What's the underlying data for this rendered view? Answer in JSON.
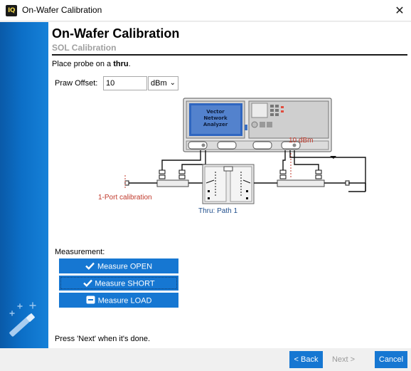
{
  "window": {
    "title": "On-Wafer Calibration",
    "app_icon_text": "IQ",
    "close_glyph": "✕"
  },
  "header": {
    "title": "On-Wafer Calibration",
    "subtitle": "SOL Calibration"
  },
  "instruction": {
    "prefix": "Place probe on a ",
    "emphasis": "thru",
    "suffix": "."
  },
  "power_offset": {
    "label": "Praw Offset:",
    "value": "10",
    "unit": "dBm"
  },
  "diagram": {
    "vna_label_line1": "Vector",
    "vna_label_line2": "Network",
    "vna_label_line3": "Analyzer",
    "power_label": "10 dBm",
    "port_label": "1-Port calibration",
    "thru_label": "Thru: Path 1"
  },
  "measurement": {
    "label": "Measurement:",
    "open_label": "Measure OPEN",
    "short_label": "Measure SHORT",
    "load_label": "Measure LOAD"
  },
  "hint": "Press 'Next' when it's done.",
  "footer": {
    "back": "< Back",
    "next": "Next >",
    "cancel": "Cancel"
  },
  "colors": {
    "accent": "#1677d2",
    "sidebar": "#0c6fc7",
    "annotation_red": "#c0392b",
    "thru_blue": "#1f4e8c"
  }
}
